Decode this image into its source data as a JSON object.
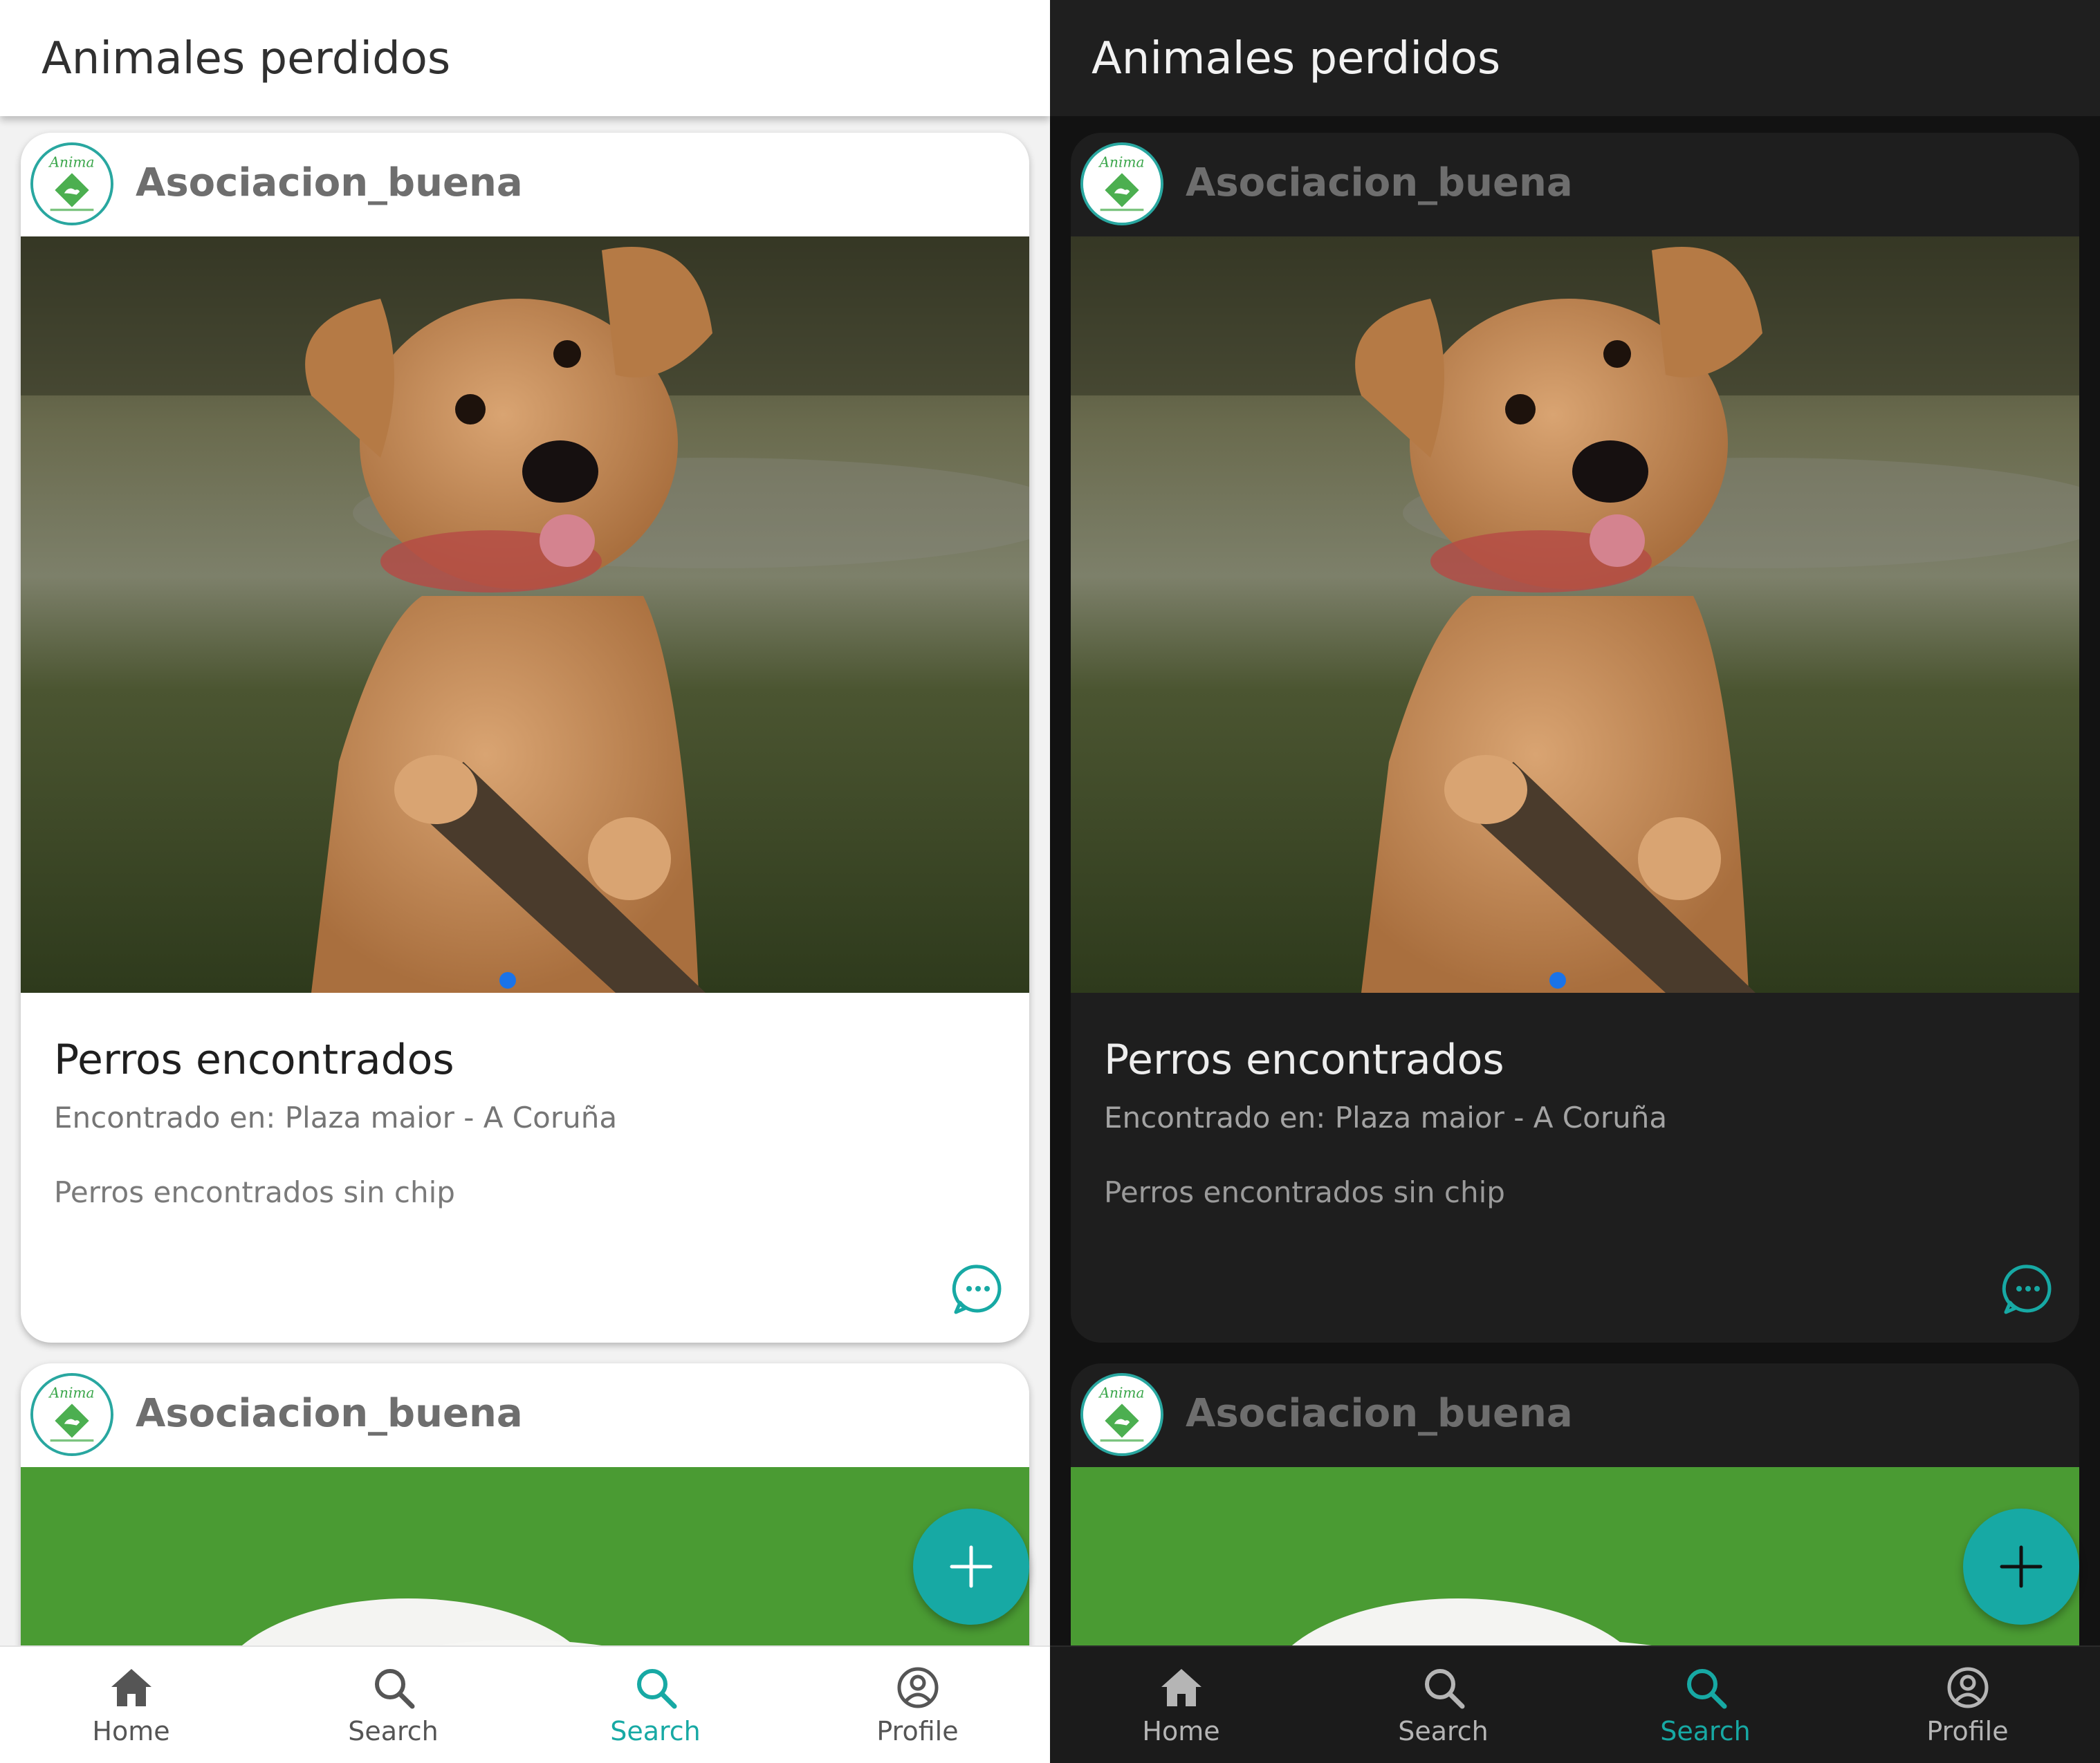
{
  "app_title": "Animales perdidos",
  "accent_color": "#17a9a4",
  "posts": [
    {
      "username": "Asociacion_buena",
      "avatar_icon": "anima-logo-icon",
      "avatar_logo_text": "Anima",
      "image_subject": "dog-on-grass-with-stick",
      "title": "Perros encontrados",
      "location": "Encontrado en: Plaza maior - A Coruña",
      "description": "Perros encontrados sin chip",
      "action_icon": "chat-bubble-icon"
    },
    {
      "username": "Asociacion_buena",
      "avatar_icon": "anima-logo-icon",
      "avatar_logo_text": "Anima",
      "image_subject": "white-dog-on-green-grass"
    }
  ],
  "fab": {
    "icon": "plus-icon"
  },
  "navbar": {
    "items": [
      {
        "label": "Home",
        "icon": "home-icon",
        "active": false
      },
      {
        "label": "Search",
        "icon": "search-icon",
        "active": false
      },
      {
        "label": "Search",
        "icon": "search-icon",
        "active": true
      },
      {
        "label": "Profile",
        "icon": "profile-icon",
        "active": false
      }
    ]
  },
  "themes": [
    "light",
    "dark"
  ]
}
